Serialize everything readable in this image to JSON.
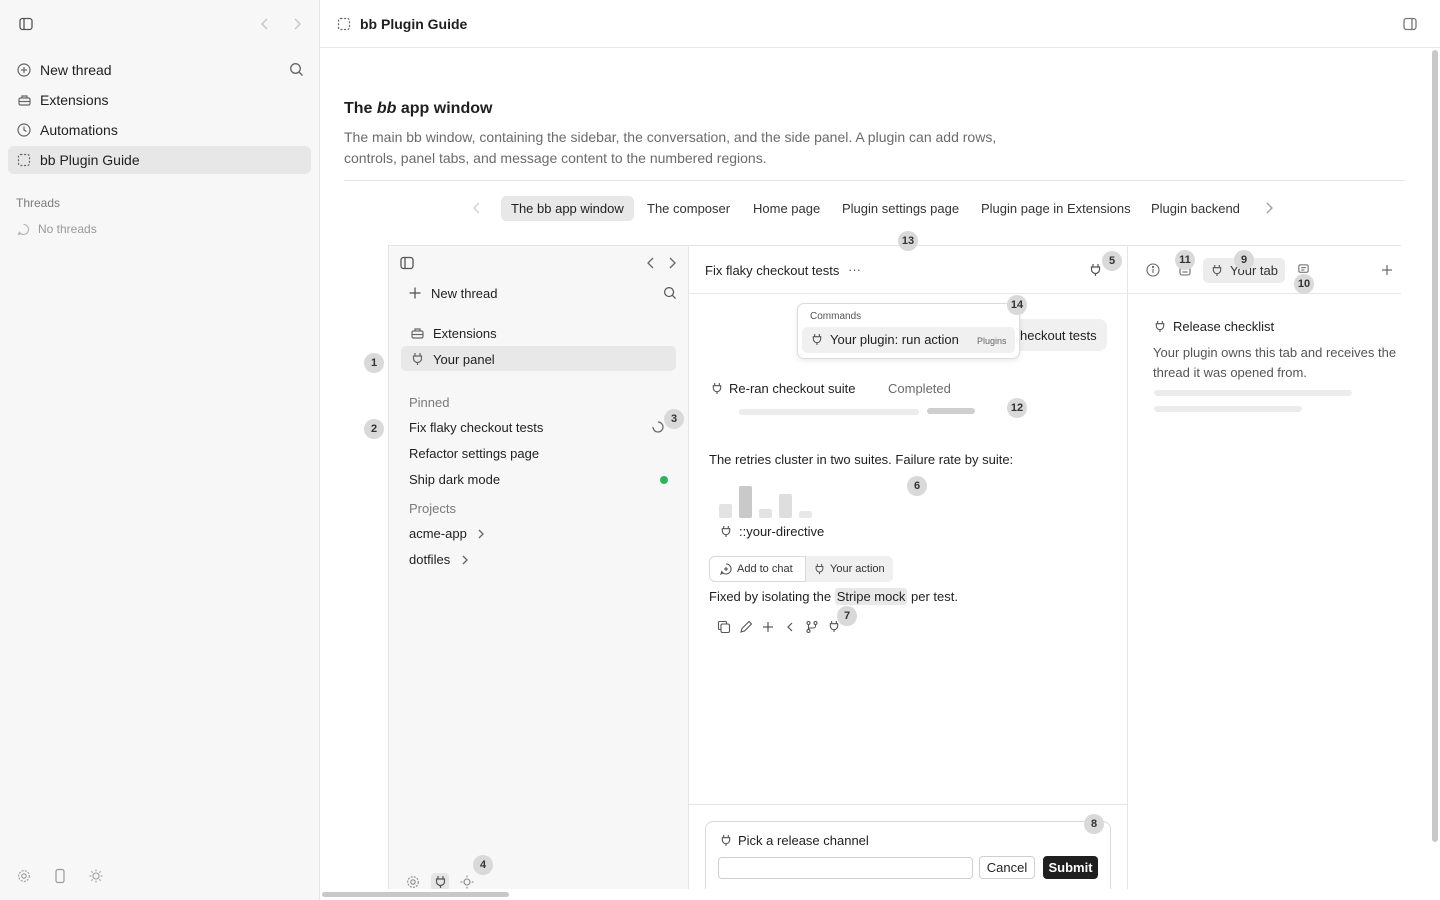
{
  "sidebar": {
    "items": [
      {
        "label": "New thread",
        "icon": "plus-circle-icon"
      },
      {
        "label": "Extensions",
        "icon": "extensions-icon"
      },
      {
        "label": "Automations",
        "icon": "clock-icon"
      },
      {
        "label": "bb Plugin Guide",
        "icon": "dashed-doc-icon"
      }
    ],
    "threads_heading": "Threads",
    "no_threads": "No threads"
  },
  "header": {
    "title": "bb Plugin Guide"
  },
  "guide": {
    "title_prefix": "The ",
    "title_em": "bb",
    "title_suffix": " app window",
    "description": "The main bb window, containing the sidebar, the conversation, and the side panel. A plugin can add rows, controls, panel tabs, and message content to the numbered regions.",
    "tabs": [
      "The bb app window",
      "The composer",
      "Home page",
      "Plugin settings page",
      "Plugin page in Extensions",
      "Plugin backend"
    ],
    "active_tab": 0
  },
  "mock": {
    "sidebar": {
      "new_thread": "New thread",
      "extensions": "Extensions",
      "your_panel": "Your panel",
      "pinned_heading": "Pinned",
      "pinned": [
        "Fix flaky checkout tests",
        "Refactor settings page",
        "Ship dark mode"
      ],
      "projects_heading": "Projects",
      "projects": [
        "acme-app",
        "dotfiles"
      ]
    },
    "conversation": {
      "title": "Fix flaky checkout tests",
      "more": "···",
      "menu_heading": "Commands",
      "menu_item": "Your plugin: run action",
      "menu_tag": "Plugins",
      "behind_chip": "heckout tests",
      "tool_label": "Re-ran checkout suite",
      "tool_status": "Completed",
      "message": "The retries cluster in two suites. Failure rate by suite:",
      "directive": "::your-directive",
      "add_to_chat": "Add to chat",
      "your_action": "Your action",
      "fixed_prefix": "Fixed by isolating the ",
      "fixed_chip": "Stripe mock",
      "fixed_suffix": " per test.",
      "composer_label": "Pick a release channel",
      "cancel": "Cancel",
      "submit": "Submit"
    },
    "panel": {
      "tab_label": "Your tab",
      "heading": "Release checklist",
      "body": "Your plugin owns this tab and receives the thread it was opened from."
    },
    "badges": [
      "1",
      "2",
      "3",
      "4",
      "5",
      "6",
      "7",
      "8",
      "9",
      "10",
      "11",
      "12",
      "13",
      "14"
    ]
  },
  "colors": {
    "accent": "#1f1f1f",
    "status_dot": "#2db45d",
    "badge": "#d9d9d9"
  }
}
